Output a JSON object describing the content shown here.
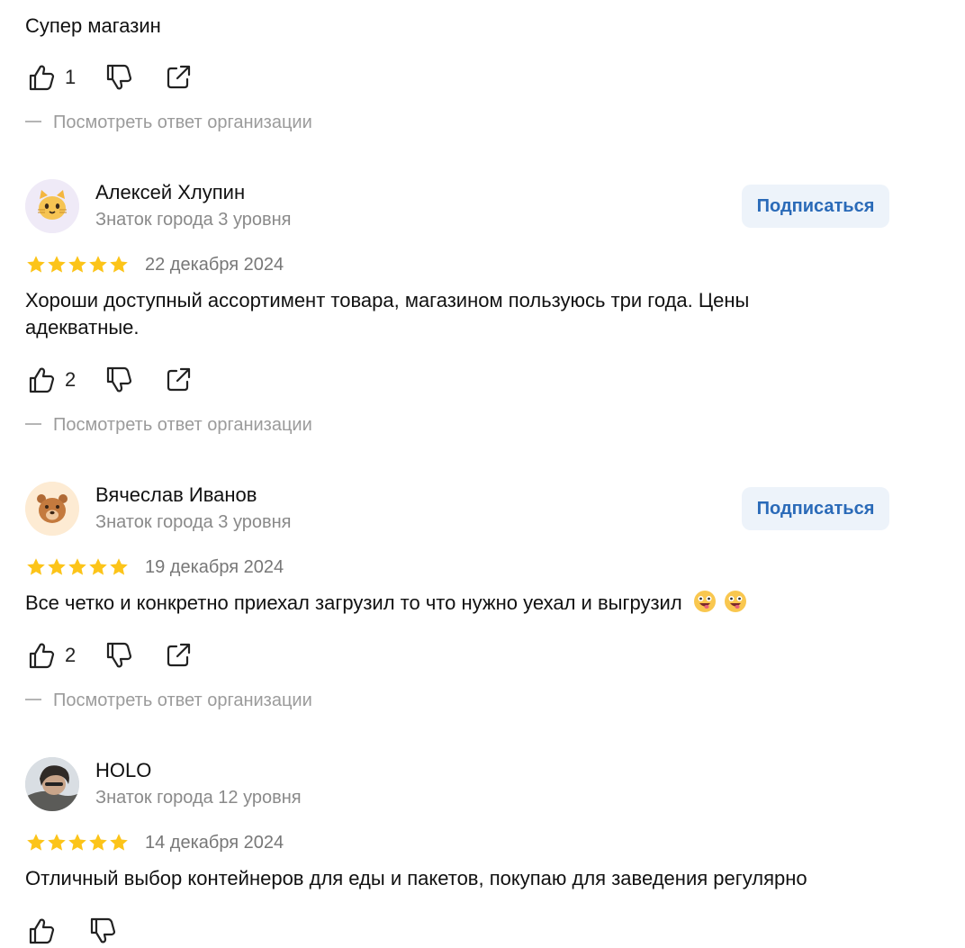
{
  "reviews": [
    {
      "text": "Супер магазин",
      "likes": "1",
      "org_reply": "Посмотреть ответ организации"
    },
    {
      "author": "Алексей Хлупин",
      "level": "Знаток города 3 уровня",
      "subscribe": "Подписаться",
      "rating": 5,
      "date": "22 декабря 2024",
      "text": "Хороши доступный ассортимент товара, магазином пользуюсь три года. Цены адекватные.",
      "likes": "2",
      "org_reply": "Посмотреть ответ организации",
      "avatar": "cat-emoji"
    },
    {
      "author": "Вячеслав Иванов",
      "level": "Знаток города 3 уровня",
      "subscribe": "Подписаться",
      "rating": 5,
      "date": "19 декабря 2024",
      "text": "Все четко и конкретно приехал загрузил то что нужно уехал и выгрузил",
      "emojis": [
        "zany-face-emoji",
        "zany-face-emoji"
      ],
      "likes": "2",
      "org_reply": "Посмотреть ответ организации",
      "avatar": "bear-emoji"
    },
    {
      "author": "HOLO",
      "level": "Знаток города 12 уровня",
      "rating": 5,
      "date": "14 декабря 2024",
      "text": "Отличный выбор контейнеров для еды и пакетов, покупаю для заведения регулярно",
      "avatar": "user-photo"
    }
  ],
  "colors": {
    "star": "#fcc419",
    "subscribe_bg": "#edf3fa",
    "subscribe_text": "#2a6ab8",
    "muted": "#8a8a8a"
  }
}
